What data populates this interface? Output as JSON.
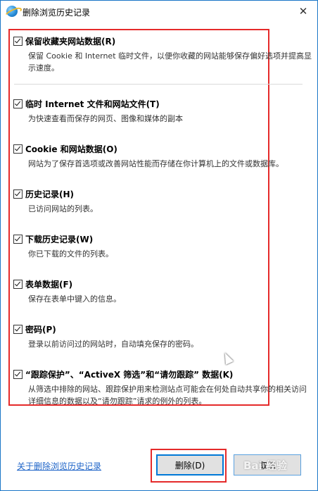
{
  "window": {
    "title": "删除浏览历史记录"
  },
  "options": [
    {
      "label": "保留收藏夹网站数据(R)",
      "desc": "保留 Cookie 和 Internet 临时文件，以便你收藏的网站能够保存偏好选项并提高显示速度。",
      "checked": true
    },
    {
      "label": "临时 Internet 文件和网站文件(T)",
      "desc": "为快速查看而保存的网页、图像和媒体的副本",
      "checked": true
    },
    {
      "label": "Cookie 和网站数据(O)",
      "desc": "网站为了保存首选项或改善网站性能而存储在你计算机上的文件或数据库。",
      "checked": true
    },
    {
      "label": "历史记录(H)",
      "desc": "已访问网站的列表。",
      "checked": true
    },
    {
      "label": "下载历史记录(W)",
      "desc": "你已下载的文件的列表。",
      "checked": true
    },
    {
      "label": "表单数据(F)",
      "desc": "保存在表单中键入的信息。",
      "checked": true
    },
    {
      "label": "密码(P)",
      "desc": "登录以前访问过的网站时，自动填充保存的密码。",
      "checked": true
    },
    {
      "label": "“跟踪保护”、“ActiveX 筛选”和“请勿跟踪” 数据(K)",
      "desc": "从筛选中排除的网站、跟踪保护用来检测站点可能会在何处自动共享你的相关访问详细信息的数据以及“请勿跟踪”请求的例外的列表。",
      "checked": true
    }
  ],
  "footer": {
    "link": "关于删除浏览历史记录",
    "delete_label": "删除(D)",
    "cancel_label": "取消"
  },
  "watermark": "Bai 经验",
  "colors": {
    "highlight": "#e52a2a",
    "link": "#1e64c8",
    "accent": "#0078d7"
  }
}
